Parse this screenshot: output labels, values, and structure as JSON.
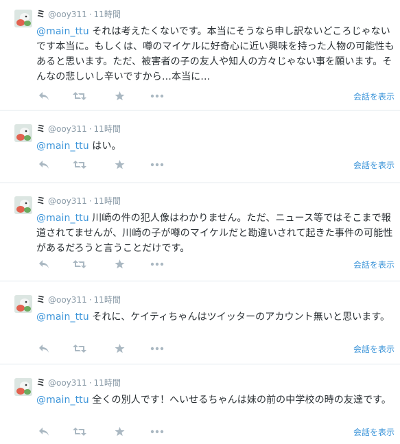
{
  "icons": [
    "reply-icon",
    "retweet-icon",
    "favorite-icon",
    "more-icon",
    "avatar"
  ],
  "colors": {
    "link": "#3b94d9",
    "muted": "#8899a6",
    "text": "#292f33",
    "icon": "#aab8c2"
  },
  "tweets": [
    {
      "name": "ミ",
      "handle": "@ooy311",
      "dot": "·",
      "time": "11時間",
      "mention": "@main_ttu",
      "text": " それは考えたくないです。本当にそうなら申し訳ないどころじゃないです本当に。もしくは、噂のマイケルに好奇心に近い興味を持った人物の可能性もあると思います。ただ、被害者の子の友人や知人の方々じゃない事を願います。そんなの悲しいし辛いですから…本当に…",
      "convo": "会話を表示"
    },
    {
      "name": "ミ",
      "handle": "@ooy311",
      "dot": "·",
      "time": "11時間",
      "mention": "@main_ttu",
      "text": " はい。",
      "convo": "会話を表示"
    },
    {
      "name": "ミ",
      "handle": "@ooy311",
      "dot": "·",
      "time": "11時間",
      "mention": "@main_ttu",
      "text": " 川崎の件の犯人像はわかりません。ただ、ニュース等ではそこまで報道されてませんが、川崎の子が噂のマイケルだと勘違いされて起きた事件の可能性があるだろうと言うことだけです。",
      "convo": "会話を表示"
    },
    {
      "name": "ミ",
      "handle": "@ooy311",
      "dot": "·",
      "time": "11時間",
      "mention": "@main_ttu",
      "text": " それに、ケイティちゃんはツイッターのアカウント無いと思います。",
      "convo": "会話を表示"
    },
    {
      "name": "ミ",
      "handle": "@ooy311",
      "dot": "·",
      "time": "11時間",
      "mention": "@main_ttu",
      "text": " 全くの別人です！へいせるちゃんは妹の前の中学校の時の友達です。",
      "convo": "会話を表示"
    }
  ]
}
